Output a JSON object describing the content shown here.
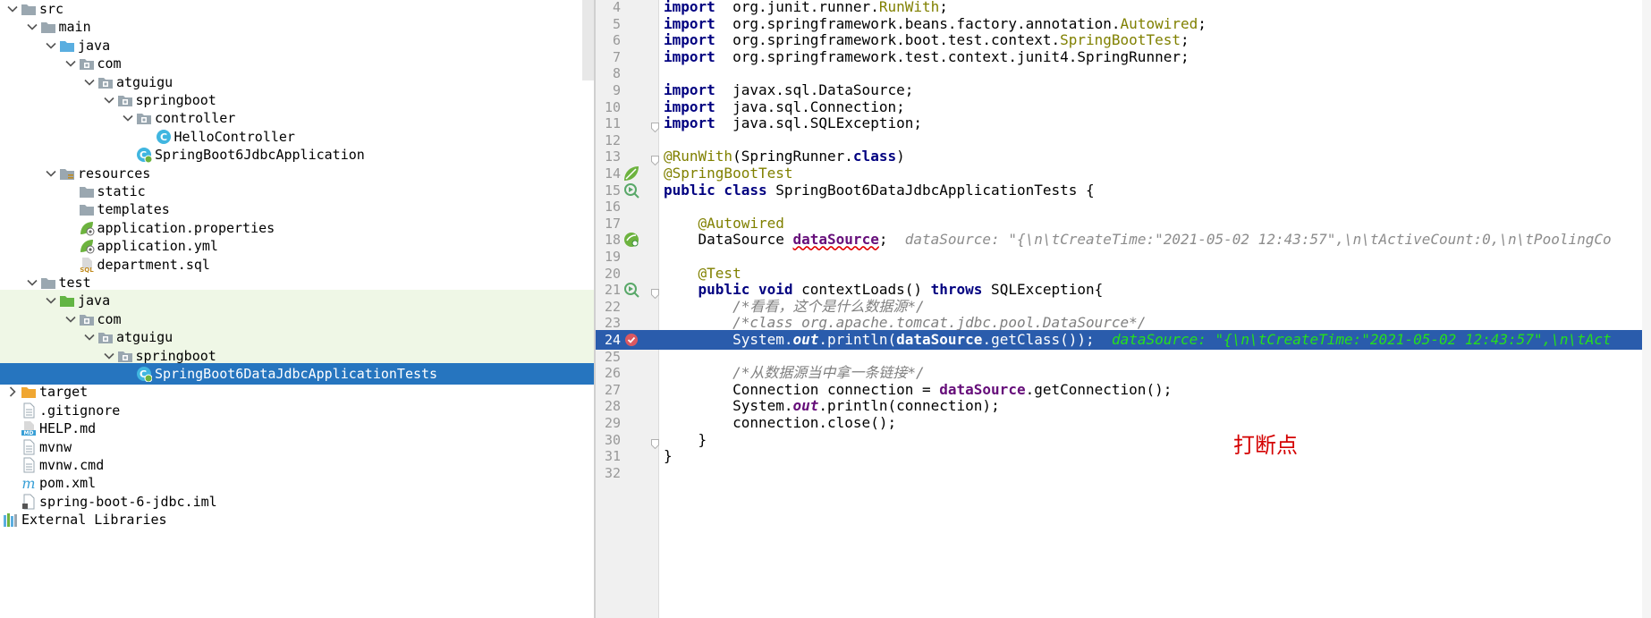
{
  "tree": {
    "rows": [
      {
        "label": "src",
        "indent": 0,
        "arrow": "down",
        "icon": "folder",
        "icon_color": "#9aa7b0",
        "bg": "normal"
      },
      {
        "label": "main",
        "indent": 1,
        "arrow": "down",
        "icon": "folder",
        "icon_color": "#9aa7b0",
        "bg": "normal"
      },
      {
        "label": "java",
        "indent": 2,
        "arrow": "down",
        "icon": "folder",
        "icon_color": "#5aaee0",
        "bg": "normal"
      },
      {
        "label": "com",
        "indent": 3,
        "arrow": "down",
        "icon": "package",
        "icon_color": "#9aa7b0",
        "bg": "normal"
      },
      {
        "label": "atguigu",
        "indent": 4,
        "arrow": "down",
        "icon": "package",
        "icon_color": "#9aa7b0",
        "bg": "normal"
      },
      {
        "label": "springboot",
        "indent": 5,
        "arrow": "down",
        "icon": "package",
        "icon_color": "#9aa7b0",
        "bg": "normal"
      },
      {
        "label": "controller",
        "indent": 6,
        "arrow": "down",
        "icon": "package",
        "icon_color": "#9aa7b0",
        "bg": "normal"
      },
      {
        "label": "HelloController",
        "indent": 7,
        "arrow": "none",
        "icon": "class",
        "icon_color": "#40b6e0",
        "bg": "normal"
      },
      {
        "label": "SpringBoot6JdbcApplication",
        "indent": 6,
        "arrow": "none",
        "icon": "spring-class",
        "icon_color": "#40b6e0",
        "bg": "normal"
      },
      {
        "label": "resources",
        "indent": 2,
        "arrow": "down",
        "icon": "resources-folder",
        "icon_color": "#9aa7b0",
        "bg": "normal"
      },
      {
        "label": "static",
        "indent": 3,
        "arrow": "none",
        "icon": "folder",
        "icon_color": "#9aa7b0",
        "bg": "normal"
      },
      {
        "label": "templates",
        "indent": 3,
        "arrow": "none",
        "icon": "folder",
        "icon_color": "#9aa7b0",
        "bg": "normal"
      },
      {
        "label": "application.properties",
        "indent": 3,
        "arrow": "none",
        "icon": "spring-leaf",
        "icon_color": "#6db33f",
        "bg": "normal"
      },
      {
        "label": "application.yml",
        "indent": 3,
        "arrow": "none",
        "icon": "spring-leaf",
        "icon_color": "#6db33f",
        "bg": "normal"
      },
      {
        "label": "department.sql",
        "indent": 3,
        "arrow": "none",
        "icon": "sql-file",
        "icon_color": "#c08a1e",
        "bg": "normal"
      },
      {
        "label": "test",
        "indent": 1,
        "arrow": "down",
        "icon": "folder",
        "icon_color": "#9aa7b0",
        "bg": "normal"
      },
      {
        "label": "java",
        "indent": 2,
        "arrow": "down",
        "icon": "folder",
        "icon_color": "#62b543",
        "bg": "test"
      },
      {
        "label": "com",
        "indent": 3,
        "arrow": "down",
        "icon": "package",
        "icon_color": "#9aa7b0",
        "bg": "test"
      },
      {
        "label": "atguigu",
        "indent": 4,
        "arrow": "down",
        "icon": "package",
        "icon_color": "#9aa7b0",
        "bg": "test"
      },
      {
        "label": "springboot",
        "indent": 5,
        "arrow": "down",
        "icon": "package",
        "icon_color": "#9aa7b0",
        "bg": "test"
      },
      {
        "label": "SpringBoot6DataJdbcApplicationTests",
        "indent": 6,
        "arrow": "none",
        "icon": "spring-class",
        "icon_color": "#40b6e0",
        "bg": "selected"
      },
      {
        "label": "target",
        "indent": 0,
        "arrow": "right",
        "icon": "folder",
        "icon_color": "#f0a732",
        "bg": "normal"
      },
      {
        "label": ".gitignore",
        "indent": 0,
        "arrow": "none",
        "icon": "text-file",
        "icon_color": "#9aa7b0",
        "bg": "normal"
      },
      {
        "label": "HELP.md",
        "indent": 0,
        "arrow": "none",
        "icon": "md-file",
        "icon_color": "#389fd6",
        "bg": "normal"
      },
      {
        "label": "mvnw",
        "indent": 0,
        "arrow": "none",
        "icon": "text-file",
        "icon_color": "#9aa7b0",
        "bg": "normal"
      },
      {
        "label": "mvnw.cmd",
        "indent": 0,
        "arrow": "none",
        "icon": "text-file",
        "icon_color": "#9aa7b0",
        "bg": "normal"
      },
      {
        "label": "pom.xml",
        "indent": 0,
        "arrow": "none",
        "icon": "maven-file",
        "icon_color": "#389fd6",
        "bg": "normal"
      },
      {
        "label": "spring-boot-6-jdbc.iml",
        "indent": 0,
        "arrow": "none",
        "icon": "iml-file",
        "icon_color": "#9aa7b0",
        "bg": "normal"
      },
      {
        "label": "External Libraries",
        "indent": -1,
        "arrow": "none",
        "icon": "libraries",
        "icon_color": "#5aaee0",
        "bg": "normal"
      }
    ]
  },
  "editor": {
    "highlighted_line": 24,
    "lines": [
      {
        "n": "4",
        "gutter": "",
        "fold": false,
        "tokens": [
          [
            "kw",
            "import"
          ],
          [
            "",
            "  org.junit.runner."
          ],
          [
            "cls",
            "RunWith"
          ],
          [
            "",
            ";"
          ]
        ]
      },
      {
        "n": "5",
        "gutter": "",
        "fold": false,
        "tokens": [
          [
            "kw",
            "import"
          ],
          [
            "",
            "  org.springframework.beans.factory.annotation."
          ],
          [
            "cls",
            "Autowired"
          ],
          [
            "",
            ";"
          ]
        ]
      },
      {
        "n": "6",
        "gutter": "",
        "fold": false,
        "tokens": [
          [
            "kw",
            "import"
          ],
          [
            "",
            "  org.springframework.boot.test.context."
          ],
          [
            "cls",
            "SpringBootTest"
          ],
          [
            "",
            ";"
          ]
        ]
      },
      {
        "n": "7",
        "gutter": "",
        "fold": false,
        "tokens": [
          [
            "kw",
            "import"
          ],
          [
            "",
            "  org.springframework.test.context.junit4.SpringRunner;"
          ]
        ]
      },
      {
        "n": "8",
        "gutter": "",
        "fold": false,
        "tokens": []
      },
      {
        "n": "9",
        "gutter": "",
        "fold": false,
        "tokens": [
          [
            "kw",
            "import"
          ],
          [
            "",
            "  javax.sql.DataSource;"
          ]
        ]
      },
      {
        "n": "10",
        "gutter": "",
        "fold": false,
        "tokens": [
          [
            "kw",
            "import"
          ],
          [
            "",
            "  java.sql.Connection;"
          ]
        ]
      },
      {
        "n": "11",
        "gutter": "",
        "fold": true,
        "tokens": [
          [
            "kw",
            "import"
          ],
          [
            "",
            "  java.sql.SQLException;"
          ]
        ]
      },
      {
        "n": "12",
        "gutter": "",
        "fold": false,
        "tokens": []
      },
      {
        "n": "13",
        "gutter": "",
        "fold": true,
        "tokens": [
          [
            "ann",
            "@RunWith"
          ],
          [
            "",
            "(SpringRunner."
          ],
          [
            "kw",
            "class"
          ],
          [
            "",
            ")"
          ]
        ]
      },
      {
        "n": "14",
        "gutter": "spring-leaf",
        "fold": false,
        "tokens": [
          [
            "ann",
            "@SpringBootTest"
          ]
        ]
      },
      {
        "n": "15",
        "gutter": "run",
        "fold": false,
        "tokens": [
          [
            "kw",
            "public class"
          ],
          [
            "",
            " SpringBoot6DataJdbcApplicationTests {"
          ]
        ]
      },
      {
        "n": "16",
        "gutter": "",
        "fold": false,
        "tokens": []
      },
      {
        "n": "17",
        "gutter": "",
        "fold": false,
        "tokens": [
          [
            "",
            "    "
          ],
          [
            "ann",
            "@Autowired"
          ]
        ]
      },
      {
        "n": "18",
        "gutter": "spring-bean",
        "fold": false,
        "tokens": [
          [
            "",
            "    DataSource "
          ],
          [
            "fld squig",
            "dataSource"
          ],
          [
            "",
            ";  "
          ],
          [
            "inl",
            "dataSource: \"{\\n\\tCreateTime:\"2021-05-02 12:43:57\",\\n\\tActiveCount:0,\\n\\tPoolingCo"
          ]
        ]
      },
      {
        "n": "19",
        "gutter": "",
        "fold": false,
        "tokens": []
      },
      {
        "n": "20",
        "gutter": "",
        "fold": false,
        "tokens": [
          [
            "",
            "    "
          ],
          [
            "ann",
            "@Test"
          ]
        ]
      },
      {
        "n": "21",
        "gutter": "run",
        "fold": true,
        "tokens": [
          [
            "",
            "    "
          ],
          [
            "kw",
            "public void"
          ],
          [
            "",
            " contextLoads() "
          ],
          [
            "kw",
            "throws"
          ],
          [
            "",
            " SQLException{"
          ]
        ]
      },
      {
        "n": "22",
        "gutter": "",
        "fold": false,
        "tokens": [
          [
            "",
            "        "
          ],
          [
            "cmt",
            "/*看看，这个是什么数据源*/"
          ]
        ]
      },
      {
        "n": "23",
        "gutter": "",
        "fold": false,
        "tokens": [
          [
            "",
            "        "
          ],
          [
            "cmt",
            "/*class org.apache.tomcat.jdbc.pool.DataSource*/"
          ]
        ]
      },
      {
        "n": "24",
        "gutter": "breakpoint",
        "fold": false,
        "tokens": [
          [
            "",
            "        System."
          ],
          [
            "static",
            "out"
          ],
          [
            "",
            ".println("
          ],
          [
            "fld",
            "dataSource"
          ],
          [
            "",
            ".getClass());  "
          ],
          [
            "inl",
            "dataSource: \"{\\n\\tCreateTime:\"2021-05-02 12:43:57\",\\n\\tAct"
          ]
        ]
      },
      {
        "n": "25",
        "gutter": "",
        "fold": false,
        "tokens": []
      },
      {
        "n": "26",
        "gutter": "",
        "fold": false,
        "tokens": [
          [
            "",
            "        "
          ],
          [
            "cmt",
            "/*从数据源当中拿一条链接*/"
          ]
        ]
      },
      {
        "n": "27",
        "gutter": "",
        "fold": false,
        "tokens": [
          [
            "",
            "        Connection connection = "
          ],
          [
            "fld",
            "dataSource"
          ],
          [
            "",
            ".getConnection();"
          ]
        ]
      },
      {
        "n": "28",
        "gutter": "",
        "fold": false,
        "tokens": [
          [
            "",
            "        System."
          ],
          [
            "static",
            "out"
          ],
          [
            "",
            ".println(connection);"
          ]
        ]
      },
      {
        "n": "29",
        "gutter": "",
        "fold": false,
        "tokens": [
          [
            "",
            "        connection.close();"
          ]
        ]
      },
      {
        "n": "30",
        "gutter": "",
        "fold": true,
        "tokens": [
          [
            "",
            "    }"
          ]
        ]
      },
      {
        "n": "31",
        "gutter": "",
        "fold": false,
        "tokens": [
          [
            "",
            "}"
          ]
        ]
      },
      {
        "n": "32",
        "gutter": "",
        "fold": false,
        "tokens": []
      }
    ]
  },
  "annotation": {
    "breakpoint_note": "打断点"
  },
  "colors": {
    "selection": "#2675bf",
    "test_root_bg": "#eff7e6",
    "current_line": "#2a5cac",
    "breakpoint": "#db5860",
    "note_red": "#d40000",
    "inline_value": "#25e01b"
  }
}
